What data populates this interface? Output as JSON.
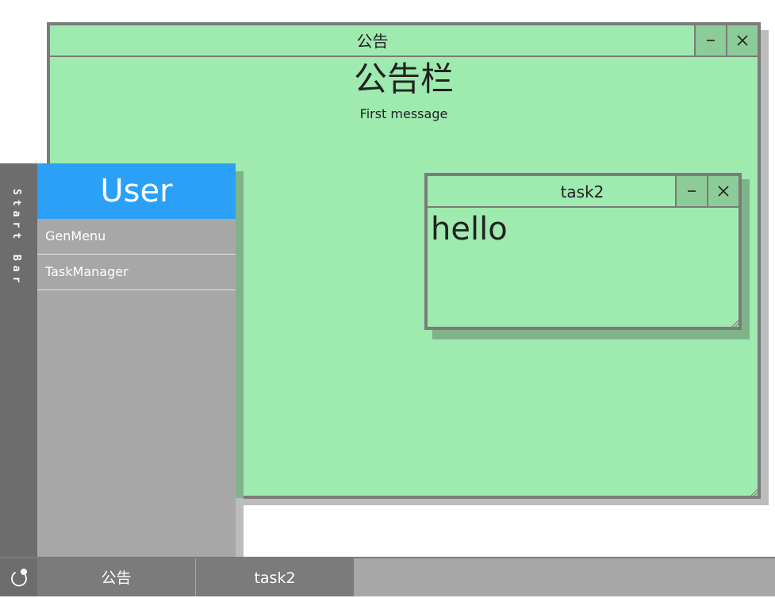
{
  "windows": {
    "main": {
      "title": "公告",
      "heading": "公告栏",
      "message": "First message",
      "minimize_icon": "minimize-icon",
      "close_icon": "close-icon"
    },
    "task2": {
      "title": "task2",
      "content": "hello",
      "minimize_icon": "minimize-icon",
      "close_icon": "close-icon"
    }
  },
  "startbar": {
    "label": "Start Bar"
  },
  "usermenu": {
    "header": "User",
    "items": [
      {
        "label": "GenMenu"
      },
      {
        "label": "TaskManager"
      }
    ]
  },
  "taskbar": {
    "start_icon": "power-icon",
    "tabs": [
      {
        "label": "公告"
      },
      {
        "label": "task2"
      }
    ]
  },
  "colors": {
    "window_bg": "#9eeaaf",
    "window_border": "#7b7b7b",
    "user_header": "#2ba0f7",
    "menu_bg": "#a7a7a7",
    "startbar_bg": "#6d6d6d"
  }
}
